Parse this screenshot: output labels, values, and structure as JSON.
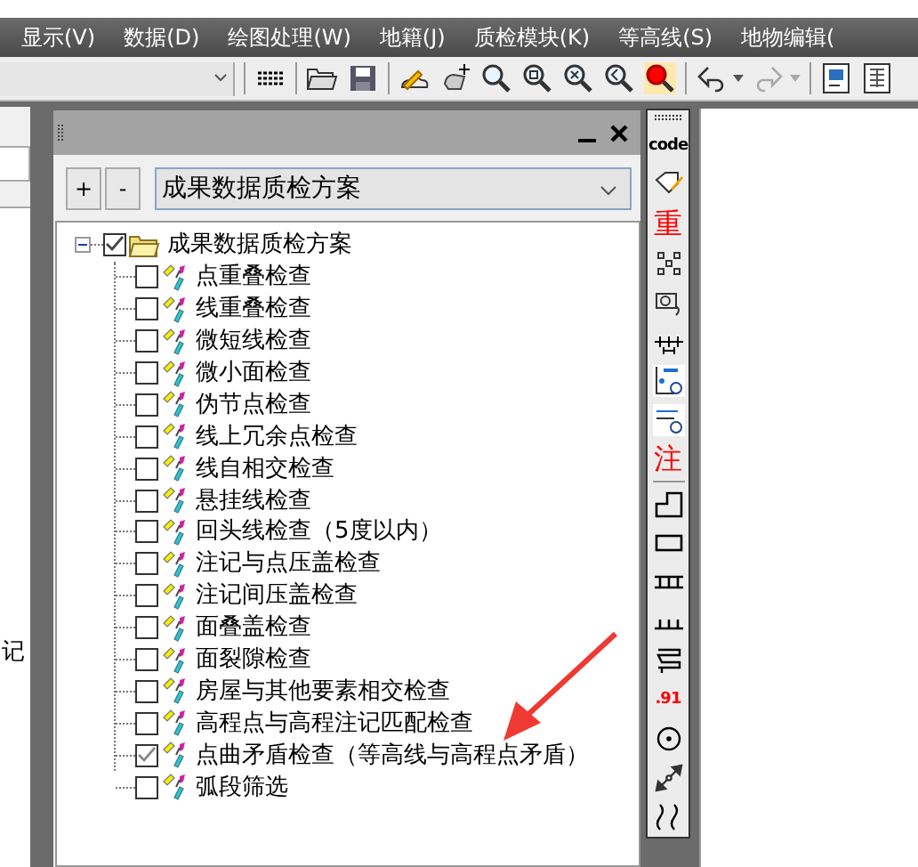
{
  "menu": [
    {
      "label": "显示(V)"
    },
    {
      "label": "数据(D)"
    },
    {
      "label": "绘图处理(W)"
    },
    {
      "label": "地籍(J)"
    },
    {
      "label": "质检模块(K)"
    },
    {
      "label": "等高线(S)"
    },
    {
      "label": "地物编辑("
    }
  ],
  "left_panel": {
    "side_text": "记"
  },
  "panel": {
    "scheme": "成果数据质检方案",
    "add_label": "+",
    "remove_label": "-",
    "tree": {
      "label": "成果数据质检方案",
      "checked": true,
      "expanded": true,
      "children": [
        {
          "label": "点重叠检查",
          "checked": false
        },
        {
          "label": "线重叠检查",
          "checked": false
        },
        {
          "label": "微短线检查",
          "checked": false
        },
        {
          "label": "微小面检查",
          "checked": false
        },
        {
          "label": "伪节点检查",
          "checked": false
        },
        {
          "label": "线上冗余点检查",
          "checked": false
        },
        {
          "label": "线自相交检查",
          "checked": false
        },
        {
          "label": "悬挂线检查",
          "checked": false
        },
        {
          "label": "回头线检查（5度以内）",
          "checked": false
        },
        {
          "label": "注记与点压盖检查",
          "checked": false
        },
        {
          "label": "注记间压盖检查",
          "checked": false
        },
        {
          "label": "面叠盖检查",
          "checked": false
        },
        {
          "label": "面裂隙检查",
          "checked": false
        },
        {
          "label": "房屋与其他要素相交检查",
          "checked": false
        },
        {
          "label": "高程点与高程注记匹配检查",
          "checked": false
        },
        {
          "label": "点曲矛盾检查（等高线与高程点矛盾）",
          "checked": true
        },
        {
          "label": "弧段筛选",
          "checked": false
        }
      ]
    }
  },
  "vertical_toolbar": [
    {
      "kind": "text",
      "label": "code",
      "color": "#000000"
    },
    {
      "kind": "icon"
    },
    {
      "kind": "text",
      "label": "重",
      "color": "#ff0000"
    },
    {
      "kind": "icon"
    },
    {
      "kind": "icon"
    },
    {
      "kind": "icon"
    },
    {
      "kind": "icon"
    },
    {
      "kind": "icon"
    },
    {
      "kind": "text",
      "label": "注",
      "color": "#ff0000"
    },
    {
      "kind": "separator"
    },
    {
      "kind": "icon"
    },
    {
      "kind": "icon"
    },
    {
      "kind": "icon"
    },
    {
      "kind": "icon"
    },
    {
      "kind": "icon"
    },
    {
      "kind": "text",
      "label": ".91",
      "color": "#ff0000"
    },
    {
      "kind": "icon"
    },
    {
      "kind": "icon"
    },
    {
      "kind": "icon"
    }
  ]
}
